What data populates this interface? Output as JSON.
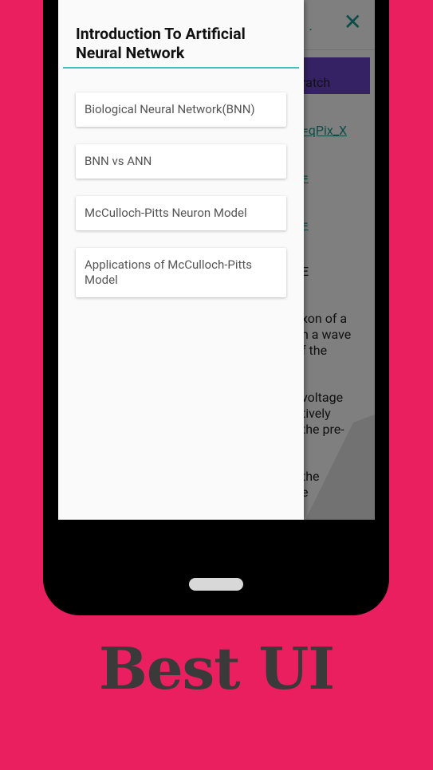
{
  "drawer": {
    "title": "Introduction To Artificial Neural Network",
    "topics": [
      {
        "label": "Biological Neural Network(BNN)"
      },
      {
        "label": "BNN vs ANN"
      },
      {
        "label": "McCulloch-Pitts Neuron Model"
      },
      {
        "label": "Applications of McCulloch-Pitts Model"
      }
    ]
  },
  "background_page": {
    "lines": [
      {
        "text": "ratch",
        "link": false
      },
      {
        "text": "=qPix_X",
        "link": true
      },
      {
        "text": "=",
        "link": true
      },
      {
        "text": "=",
        "link": true
      },
      {
        "text": "E",
        "link": false
      },
      {
        "text": "xon of a",
        "link": false
      },
      {
        "text": "n a wave",
        "link": false
      },
      {
        "text": "f the",
        "link": false
      },
      {
        "text": "voltage",
        "link": false
      },
      {
        "text": "tively",
        "link": false
      },
      {
        "text": "the pre-",
        "link": false
      },
      {
        "text": "the",
        "link": false
      },
      {
        "text": "e",
        "link": false
      }
    ]
  },
  "caption": "Best UI",
  "colors": {
    "background": "#ea1f60",
    "accent": "#3ac6bd",
    "banner": "#6a44c9"
  }
}
